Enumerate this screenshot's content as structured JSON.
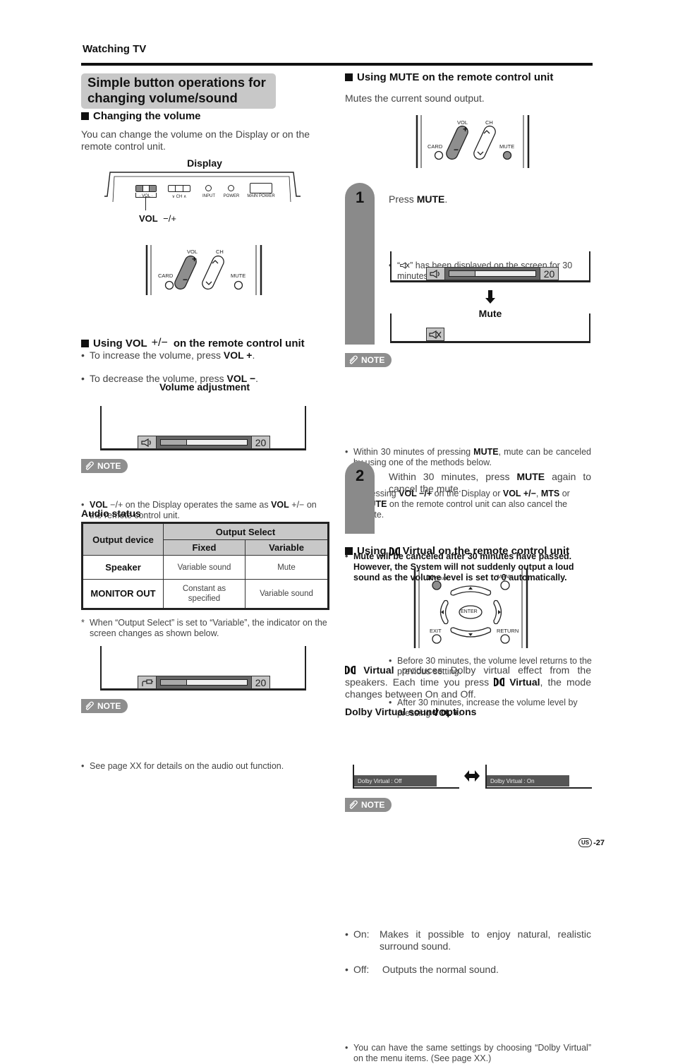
{
  "header": {
    "section": "Watching TV"
  },
  "title": {
    "line1": "Simple button operations for",
    "line2": "changing volume/sound"
  },
  "changing_volume": {
    "heading": "Changing the volume",
    "body": "You can change the volume on the Display or on the remote control unit.",
    "display_caption": "Display",
    "display_panel": {
      "vol": "· VOL ·",
      "ch": "∨ CH ∧",
      "input": "INPUT",
      "power": "POWER",
      "main_power": "MAIN POWER"
    },
    "vol_label": "VOL",
    "vol_symbol": "−/+"
  },
  "remote": {
    "vol": "VOL",
    "ch": "CH",
    "card": "CARD",
    "mute": "MUTE",
    "plus": "+",
    "minus": "−"
  },
  "using_vol": {
    "heading_pre": "Using VOL",
    "heading_sym": "+/−",
    "heading_post": "on the remote control unit",
    "bullets": [
      {
        "text": "To increase the volume, press ",
        "bold": "VOL +",
        "end": "."
      },
      {
        "text": "To decrease the volume, press ",
        "bold": "VOL −",
        "end": "."
      }
    ],
    "caption": "Volume adjustment",
    "osd": {
      "icon": "speaker-icon",
      "level_fraction": 0.3,
      "value": "20"
    }
  },
  "note_label": "NOTE",
  "note1": {
    "b1": "VOL",
    "t1": " −/+ on the Display operates the same as ",
    "b2": "VOL",
    "t2": " +/− on the remote control unit."
  },
  "audio_status": {
    "heading": "Audio status",
    "columns": {
      "device": "Output device",
      "group": "Output Select",
      "fixed": "Fixed",
      "variable": "Variable"
    },
    "rows": [
      {
        "device": "Speaker",
        "fixed": "Variable sound",
        "variable": "Mute"
      },
      {
        "device": "MONITOR OUT",
        "fixed": "Constant as specified",
        "variable": "Variable sound"
      }
    ],
    "footnote": "When “Output Select” is set to “Variable”, the indicator on the screen changes as shown below.",
    "footnote_mark": "*",
    "osd": {
      "icon": "audio-out-plug-icon",
      "level_fraction": 0.3,
      "value": "20"
    }
  },
  "note2": {
    "text": "See page XX for details on the audio out function."
  },
  "mute_section": {
    "heading": "Using MUTE on the remote control unit",
    "body": "Mutes the current sound output.",
    "step1": {
      "number": "1",
      "text_pre": "Press ",
      "text_bold": "MUTE",
      "text_end": ".",
      "bullet_pre": "“",
      "bullet_post": "” has been displayed on the screen for 30 minutes, and the sound is silenced.",
      "osd": {
        "icon": "speaker-icon",
        "level_fraction": 0.3,
        "value": "20"
      },
      "arrow_label": "Mute",
      "mute_icon": "speaker-muted-icon"
    },
    "note": {
      "b1_pre": "Within 30 minutes of pressing ",
      "b1_bold": "MUTE",
      "b1_post": ", mute can be canceled by using one of the methods below.",
      "sub_pre": "Pressing ",
      "sub_b1": "VOL −/+",
      "sub_t1": " on the Display or ",
      "sub_b2": "VOL +/−",
      "sub_t2": ", ",
      "sub_b3": "MTS",
      "sub_t3": " or ",
      "sub_b4": "MUTE",
      "sub_t4": " on the remote control unit can also cancel the mute.",
      "b2": "Mute will be canceled after 30 minutes have passed. However, the System will not suddenly output a loud sound as the volume level is set to 0 automatically."
    },
    "step2": {
      "number": "2",
      "text_pre": "Within 30 minutes, press ",
      "text_bold": "MUTE",
      "text_post": " again to cancel the mute.",
      "bullets": [
        {
          "text": "Before 30 minutes, the volume level returns to the previous setting."
        },
        {
          "text": "After 30 minutes, increase the volume level by pressing ",
          "bold": "VOL +",
          "end": "."
        }
      ]
    }
  },
  "virtual_section": {
    "heading_pre": "Using",
    "heading_post": "Virtual on the remote control unit",
    "remote": {
      "virtual": "Virtual",
      "menu": "MENU",
      "enter": "ENTER",
      "exit": "EXIT",
      "return": "RETURN"
    },
    "body_bold1": "Virtual",
    "body_t1": " produces Dolby virtual effect from the speakers. Each time you press ",
    "body_bold2": "Virtual",
    "body_t2": ", the mode changes between On and Off.",
    "options_heading": "Dolby Virtual sound options",
    "options": [
      {
        "label": "On:",
        "text": "Makes it possible to enjoy natural, realistic surround sound."
      },
      {
        "label": "Off:",
        "text": "Outputs the normal sound."
      }
    ],
    "osd_off": "Dolby Virtual : Off",
    "osd_on": "Dolby Virtual : On",
    "note": "You can have the same settings by choosing “Dolby Virtual” on the menu items. (See page XX.)"
  },
  "footer": {
    "region": "US",
    "page": "-27"
  }
}
